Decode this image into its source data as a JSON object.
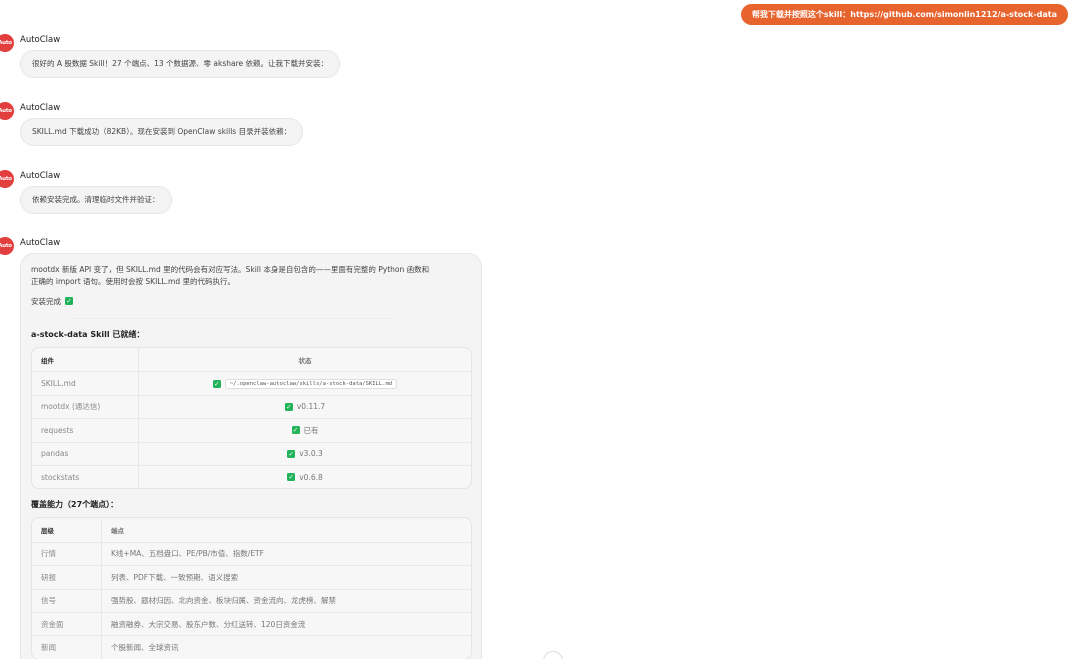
{
  "user_message": "帮我下载并按照这个skill：https://github.com/simonlin1212/a-stock-data",
  "avatar_text": "Auto",
  "messages": [
    {
      "sender": "AutoClaw",
      "text": "很好的 A 股数据 Skill！27 个端点、13 个数据源、零 akshare 依赖。让我下载并安装："
    },
    {
      "sender": "AutoClaw",
      "text": "SKILL.md 下载成功（82KB）。现在安装到 OpenClaw skills 目录并装依赖："
    },
    {
      "sender": "AutoClaw",
      "text": "依赖安装完成。清理临时文件并验证："
    }
  ],
  "final": {
    "sender": "AutoClaw",
    "line1": "mootdx 新版 API 变了，但 SKILL.md 里的代码会有对应写法。Skill 本身是自包含的——里面有完整的 Python 函数和",
    "line2": "正确的 import 语句。使用时会按 SKILL.md 里的代码执行。",
    "done_text": "安装完成",
    "check_glyph": "✓",
    "ready_title": "a-stock-data Skill 已就绪：",
    "components": {
      "headers": [
        "组件",
        "状态"
      ],
      "rows": [
        {
          "name": "SKILL.md",
          "status": "~/.openclaw-autoclaw/skills/a-stock-data/SKILL.md"
        },
        {
          "name": "mootdx (通达信)",
          "status": "v0.11.7"
        },
        {
          "name": "requests",
          "status": "已有"
        },
        {
          "name": "pandas",
          "status": "v3.0.3"
        },
        {
          "name": "stockstats",
          "status": "v0.6.8"
        }
      ]
    },
    "coverage_title": "覆盖能力（27个端点）：",
    "coverage": {
      "headers": [
        "层级",
        "端点"
      ],
      "rows": [
        {
          "layer": "行情",
          "endpoints": "K线+MA、五档盘口、PE/PB/市值、指数/ETF"
        },
        {
          "layer": "研报",
          "endpoints": "列表、PDF下载、一致预期、语义搜索"
        },
        {
          "layer": "信号",
          "endpoints": "强势股、题材归因、北向资金、板块归属、资金流向、龙虎榜、解禁"
        },
        {
          "layer": "资金面",
          "endpoints": "融资融券、大宗交易、股东户数、分红送转、120日资金流"
        },
        {
          "layer": "新闻",
          "endpoints": "个股新闻、全球资讯"
        }
      ]
    }
  }
}
